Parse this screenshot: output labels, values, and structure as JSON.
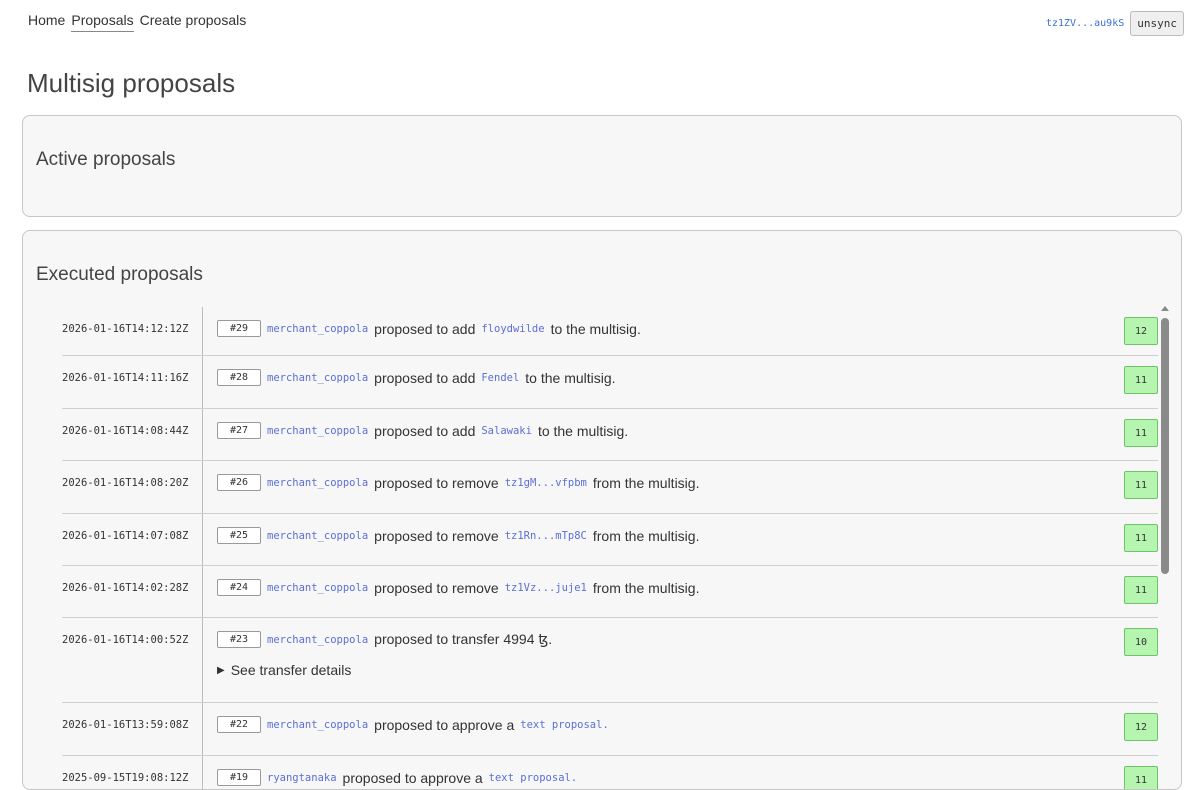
{
  "nav": {
    "items": [
      {
        "label": "Home",
        "active": false
      },
      {
        "label": "Proposals",
        "active": true
      },
      {
        "label": "Create proposals",
        "active": false
      }
    ]
  },
  "account": {
    "address": "tz1ZV...au9kS",
    "unsync_label": "unsync"
  },
  "page_title": "Multisig proposals",
  "active": {
    "title": "Active proposals"
  },
  "executed": {
    "title": "Executed proposals",
    "rows": [
      {
        "ts": "2026-01-16T14:12:12Z",
        "num": "#29",
        "who": "merchant_coppola",
        "pre": "proposed to add",
        "target": "floydwilde",
        "post": "to the multisig.",
        "count": "12"
      },
      {
        "ts": "2026-01-16T14:11:16Z",
        "num": "#28",
        "who": "merchant_coppola",
        "pre": "proposed to add",
        "target": "Fendel",
        "post": "to the multisig.",
        "count": "11"
      },
      {
        "ts": "2026-01-16T14:08:44Z",
        "num": "#27",
        "who": "merchant_coppola",
        "pre": "proposed to add",
        "target": "Salawaki",
        "post": "to the multisig.",
        "count": "11"
      },
      {
        "ts": "2026-01-16T14:08:20Z",
        "num": "#26",
        "who": "merchant_coppola",
        "pre": "proposed to remove",
        "target": "tz1gM...vfpbm",
        "post": "from the multisig.",
        "count": "11"
      },
      {
        "ts": "2026-01-16T14:07:08Z",
        "num": "#25",
        "who": "merchant_coppola",
        "pre": "proposed to remove",
        "target": "tz1Rn...mTp8C",
        "post": "from the multisig.",
        "count": "11"
      },
      {
        "ts": "2026-01-16T14:02:28Z",
        "num": "#24",
        "who": "merchant_coppola",
        "pre": "proposed to remove",
        "target": "tz1Vz...juje1",
        "post": "from the multisig.",
        "count": "11"
      },
      {
        "ts": "2026-01-16T14:00:52Z",
        "num": "#23",
        "who": "merchant_coppola",
        "pre": "proposed to transfer 4994 ꜩ.",
        "target": "",
        "post": "",
        "count": "10",
        "details": "See transfer details"
      },
      {
        "ts": "2026-01-16T13:59:08Z",
        "num": "#22",
        "who": "merchant_coppola",
        "pre": "proposed to approve a",
        "target": "text proposal.",
        "post": "",
        "count": "12"
      },
      {
        "ts": "2025-09-15T19:08:12Z",
        "num": "#19",
        "who": "ryangtanaka",
        "pre": "proposed to approve a",
        "target": "text proposal.",
        "post": "",
        "count": "11"
      }
    ]
  },
  "colors": {
    "count_bg": "#b6f5b0",
    "link": "#5b6fd6"
  }
}
